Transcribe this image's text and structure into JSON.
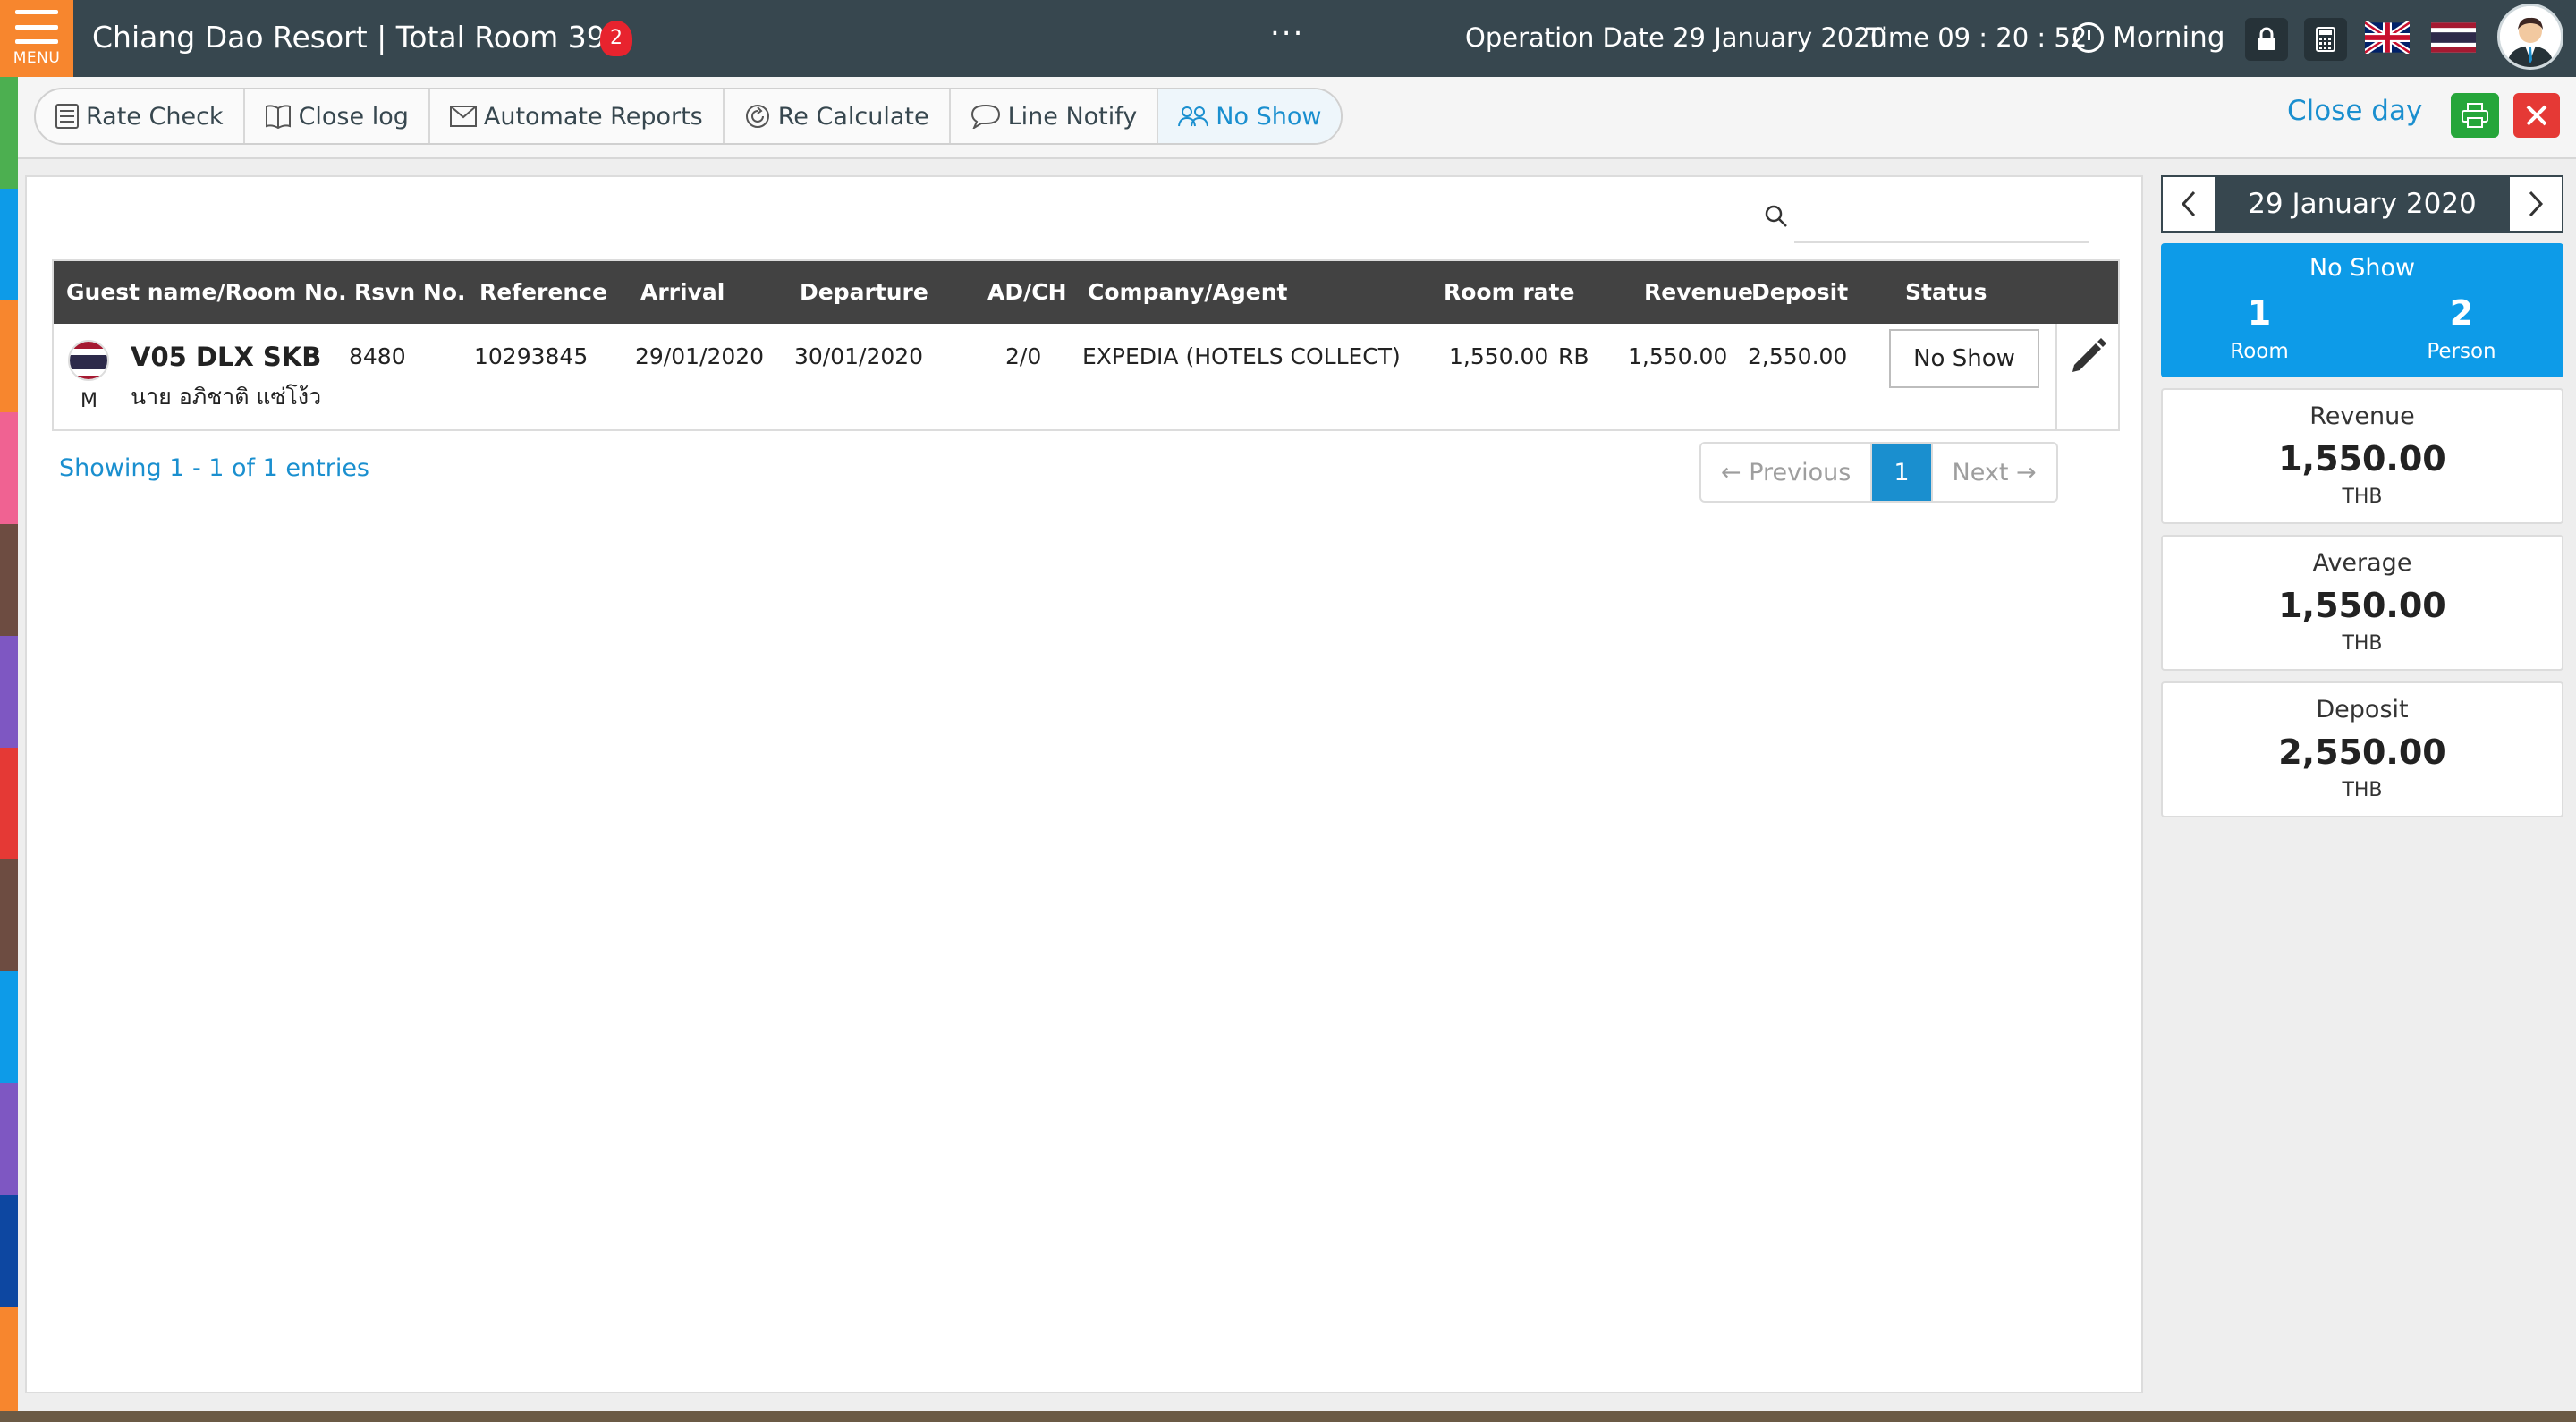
{
  "header": {
    "menu_label": "MENU",
    "title": "Chiang Dao Resort | Total Room 39",
    "notification_count": "2",
    "more_dots": "...",
    "operation_date": "Operation Date 29 January 2020",
    "time": "Time 09 : 20 : 52",
    "shift": "Morning"
  },
  "toolbar": {
    "buttons": [
      {
        "label": "Rate Check",
        "icon": "list-icon"
      },
      {
        "label": "Close log",
        "icon": "book-icon"
      },
      {
        "label": "Automate Reports",
        "icon": "mail-icon"
      },
      {
        "label": "Re Calculate",
        "icon": "refresh-icon"
      },
      {
        "label": "Line Notify",
        "icon": "chat-icon"
      },
      {
        "label": "No Show",
        "icon": "people-icon",
        "active": true
      }
    ],
    "close_day": "Close day"
  },
  "search": {
    "placeholder": ""
  },
  "table": {
    "columns": [
      "Guest name/Room No.",
      "Rsvn No.",
      "Reference",
      "Arrival",
      "Departure",
      "AD/CH",
      "Company/Agent",
      "Room rate",
      "Revenue",
      "Deposit",
      "Status"
    ],
    "rows": [
      {
        "room": "V05 DLX SKB",
        "guest": "นาย อภิชาติ แซ่โง้ว",
        "gender": "M",
        "rsvn": "8480",
        "reference": "10293845",
        "arrival": "29/01/2020",
        "departure": "30/01/2020",
        "adch": "2/0",
        "company": "EXPEDIA (HOTELS COLLECT)",
        "room_rate": "1,550.00",
        "rate_type": "RB",
        "revenue": "1,550.00",
        "deposit": "2,550.00",
        "status": "No Show"
      }
    ]
  },
  "entries_info": "Showing 1 - 1 of 1 entries",
  "pagination": {
    "previous": "← Previous",
    "current": "1",
    "next": "Next →"
  },
  "side": {
    "date": "29 January 2020",
    "noshow": {
      "title": "No Show",
      "room_count": "1",
      "room_label": "Room",
      "person_count": "2",
      "person_label": "Person"
    },
    "revenue": {
      "title": "Revenue",
      "value": "1,550.00",
      "unit": "THB"
    },
    "average": {
      "title": "Average",
      "value": "1,550.00",
      "unit": "THB"
    },
    "deposit": {
      "title": "Deposit",
      "value": "2,550.00",
      "unit": "THB"
    }
  },
  "colors": {
    "topbar": "#37474f",
    "menu": "#f7862e",
    "accent": "#1a8fcf",
    "noshow_card": "#0d9be8",
    "print": "#26a63a",
    "close": "#e53935",
    "strip": [
      "#4caf50",
      "#0d9be8",
      "#f7862e",
      "#f06292",
      "#6d4c41",
      "#7e57c2",
      "#e53935",
      "#6d4c41",
      "#0d9be8",
      "#7e57c2",
      "#0d47a1",
      "#f7862e"
    ]
  }
}
